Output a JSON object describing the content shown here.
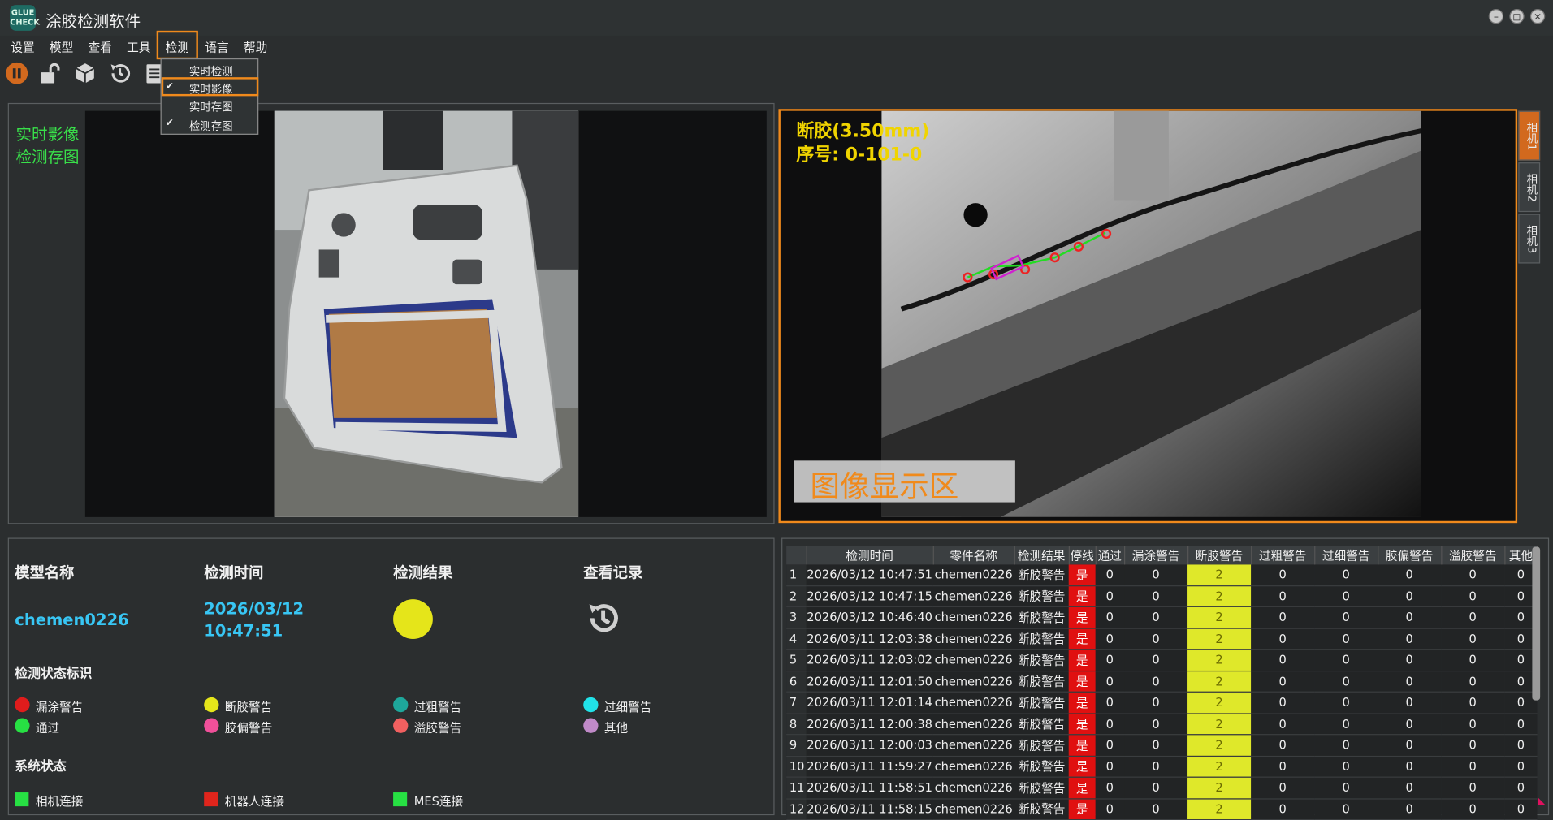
{
  "app": {
    "logo_text": "GLUE\nCHECK",
    "title": "涂胶检测软件"
  },
  "menu": [
    "设置",
    "模型",
    "查看",
    "工具",
    "检测",
    "语言",
    "帮助"
  ],
  "dropdown": [
    {
      "label": "实时检测",
      "checked": false
    },
    {
      "label": "实时影像",
      "checked": true
    },
    {
      "label": "实时存图",
      "checked": false
    },
    {
      "label": "检测存图",
      "checked": true
    }
  ],
  "left_view": {
    "label_1": "实时影像",
    "label_2": "检测存图"
  },
  "right_view": {
    "overlay_title": "断胶(3.50mm)",
    "overlay_seq": "序号: 0-101-0",
    "display_area_label": "图像显示区",
    "camera_tabs": [
      "相机1",
      "相机2",
      "相机3"
    ]
  },
  "info": {
    "model_heading": "模型名称",
    "time_heading": "检测时间",
    "result_heading": "检测结果",
    "history_heading": "查看记录",
    "model_name": "chemen0226",
    "detect_date": "2026/03/12",
    "detect_clock": "10:47:51",
    "result_color": "#e5e51a",
    "status_legend_heading": "检测状态标识",
    "legend": [
      {
        "label": "漏涂警告",
        "color": "#e01c1c"
      },
      {
        "label": "断胶警告",
        "color": "#e5e51a"
      },
      {
        "label": "过粗警告",
        "color": "#1ea79b"
      },
      {
        "label": "过细警告",
        "color": "#21e2e8"
      },
      {
        "label": "通过",
        "color": "#27e043"
      },
      {
        "label": "胶偏警告",
        "color": "#f0509a"
      },
      {
        "label": "溢胶警告",
        "color": "#f26060"
      },
      {
        "label": "其他",
        "color": "#c08ac8"
      }
    ],
    "system_status_heading": "系统状态",
    "system_status": [
      {
        "label": "相机连接",
        "color": "#27e043"
      },
      {
        "label": "机器人连接",
        "color": "#e0251c"
      },
      {
        "label": "MES连接",
        "color": "#27e043"
      }
    ]
  },
  "table": {
    "headers": [
      "检测时间",
      "零件名称",
      "检测结果",
      "停线",
      "通过",
      "漏涂警告",
      "断胶警告",
      "过粗警告",
      "过细警告",
      "胶偏警告",
      "溢胶警告",
      "其他"
    ],
    "rows": [
      [
        "1",
        "2026/03/12 10:47:51",
        "chemen0226",
        "断胶警告",
        "是",
        "0",
        "0",
        "2",
        "0",
        "0",
        "0",
        "0",
        "0"
      ],
      [
        "2",
        "2026/03/12 10:47:15",
        "chemen0226",
        "断胶警告",
        "是",
        "0",
        "0",
        "2",
        "0",
        "0",
        "0",
        "0",
        "0"
      ],
      [
        "3",
        "2026/03/12 10:46:40",
        "chemen0226",
        "断胶警告",
        "是",
        "0",
        "0",
        "2",
        "0",
        "0",
        "0",
        "0",
        "0"
      ],
      [
        "4",
        "2026/03/11 12:03:38",
        "chemen0226",
        "断胶警告",
        "是",
        "0",
        "0",
        "2",
        "0",
        "0",
        "0",
        "0",
        "0"
      ],
      [
        "5",
        "2026/03/11 12:03:02",
        "chemen0226",
        "断胶警告",
        "是",
        "0",
        "0",
        "2",
        "0",
        "0",
        "0",
        "0",
        "0"
      ],
      [
        "6",
        "2026/03/11 12:01:50",
        "chemen0226",
        "断胶警告",
        "是",
        "0",
        "0",
        "2",
        "0",
        "0",
        "0",
        "0",
        "0"
      ],
      [
        "7",
        "2026/03/11 12:01:14",
        "chemen0226",
        "断胶警告",
        "是",
        "0",
        "0",
        "2",
        "0",
        "0",
        "0",
        "0",
        "0"
      ],
      [
        "8",
        "2026/03/11 12:00:38",
        "chemen0226",
        "断胶警告",
        "是",
        "0",
        "0",
        "2",
        "0",
        "0",
        "0",
        "0",
        "0"
      ],
      [
        "9",
        "2026/03/11 12:00:03",
        "chemen0226",
        "断胶警告",
        "是",
        "0",
        "0",
        "2",
        "0",
        "0",
        "0",
        "0",
        "0"
      ],
      [
        "10",
        "2026/03/11 11:59:27",
        "chemen0226",
        "断胶警告",
        "是",
        "0",
        "0",
        "2",
        "0",
        "0",
        "0",
        "0",
        "0"
      ],
      [
        "11",
        "2026/03/11 11:58:51",
        "chemen0226",
        "断胶警告",
        "是",
        "0",
        "0",
        "2",
        "0",
        "0",
        "0",
        "0",
        "0"
      ],
      [
        "12",
        "2026/03/11 11:58:15",
        "chemen0226",
        "断胶警告",
        "是",
        "0",
        "0",
        "2",
        "0",
        "0",
        "0",
        "0",
        "0"
      ]
    ]
  }
}
